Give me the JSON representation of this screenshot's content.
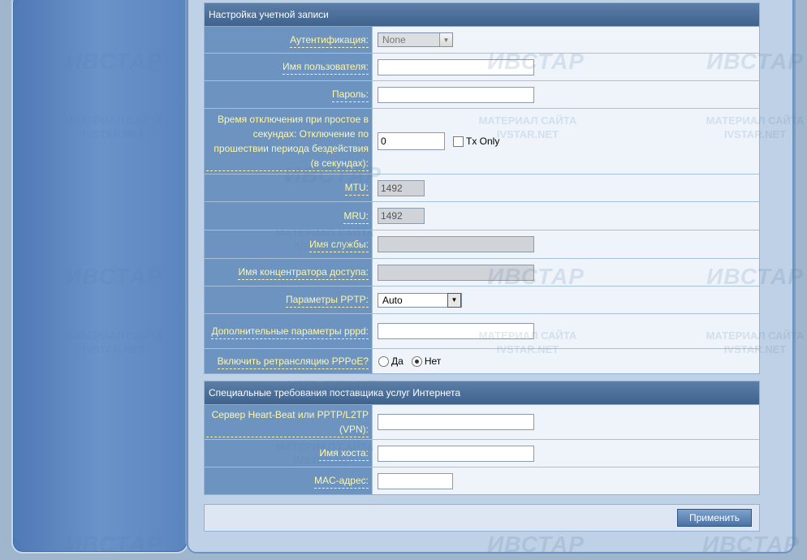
{
  "account_section": {
    "title": "Настройка учетной записи",
    "auth_label": "Аутентификация:",
    "auth_value": "None",
    "username_label": "Имя пользователя:",
    "username_value": "",
    "password_label": "Пароль:",
    "password_value": "",
    "idle_label": "Время отключения при простое в секундах: Отключение по прошествии периода бездействия (в секундах):",
    "idle_value": "0",
    "tx_only_label": "Tx Only",
    "mtu_label": "MTU:",
    "mtu_value": "1492",
    "mru_label": "MRU:",
    "mru_value": "1492",
    "service_label": "Имя службы:",
    "service_value": "",
    "concentrator_label": "Имя концентратора доступа:",
    "concentrator_value": "",
    "pptp_label": "Параметры PPTP:",
    "pptp_value": "Auto",
    "pppd_label": "Дополнительные параметры pppd:",
    "pppd_value": "",
    "relay_label": "Включить ретрансляцию PPPoE?",
    "relay_yes": "Да",
    "relay_no": "Нет"
  },
  "isp_section": {
    "title": "Специальные требования поставщика услуг Интернета",
    "heartbeat_label": "Сервер Heart-Beat или PPTP/L2TP (VPN):",
    "heartbeat_value": "",
    "host_label": "Имя хоста:",
    "host_value": "",
    "mac_label": "MAC-адрес:",
    "mac_value": ""
  },
  "apply_label": "Применить",
  "watermark": {
    "logo": "ИВСТАР",
    "line1": "МАТЕРИАЛ САЙТА",
    "line2": "IVSTAR.NET"
  }
}
